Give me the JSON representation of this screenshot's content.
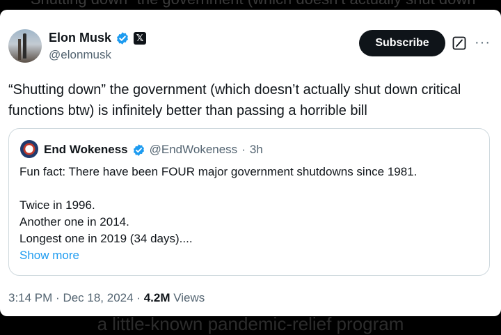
{
  "background_text": {
    "top": "“Shutting down” the government (which doesn’t actually shut down",
    "bottom": "a little-known pandemic-relief program"
  },
  "tweet": {
    "author_name": "Elon Musk",
    "author_handle": "@elonmusk",
    "subscribe_label": "Subscribe",
    "more_label": "···",
    "text": "“Shutting down” the government (which doesn’t actually shut down critical functions btw) is infinitely better than passing a horrible bill",
    "time": "3:14 PM",
    "date": "Dec 18, 2024",
    "views_count": "4.2M",
    "views_label": "Views"
  },
  "quote": {
    "author_name": "End Wokeness",
    "author_handle": "@EndWokeness",
    "age": "3h",
    "lines": [
      "Fun fact: There have been FOUR major government shutdowns since 1981.",
      "",
      "Twice in 1996.",
      "Another one in 2014.",
      "Longest one in 2019 (34 days)...."
    ],
    "show_more": "Show more"
  },
  "colors": {
    "verified_blue": "#1d9bf0",
    "text_primary": "#0f1419",
    "text_secondary": "#536471"
  },
  "icons": [
    "verified-badge-icon",
    "x-logo-icon",
    "grok-icon",
    "more-icon"
  ]
}
